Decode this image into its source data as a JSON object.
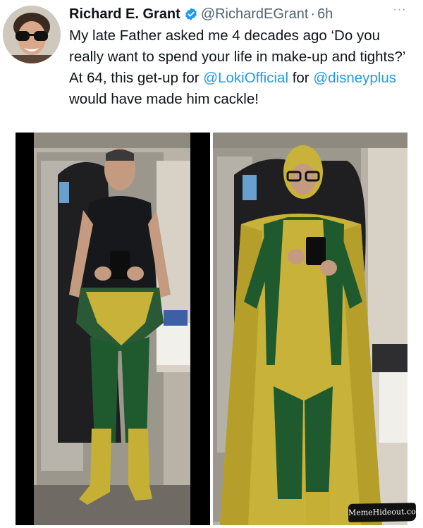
{
  "tweet": {
    "author": {
      "display_name": "Richard E. Grant",
      "handle": "@RichardEGrant",
      "separator": "·",
      "time": "6h",
      "verified_icon": "verified-badge-icon",
      "avatar": "profile-avatar"
    },
    "more_label": "···",
    "text": {
      "line_1": "My late Father asked me 4 decades ago ‘Do you really want to spend your life in make-up and tights?’  At 64, this get-up for ",
      "mention_1": "@LokiOfficial",
      "middle": " for ",
      "mention_2": "@disneyplus",
      "end": " would have made him cackle!"
    },
    "media": {
      "photos": [
        {
          "name": "mirror-selfie-costume-top-off"
        },
        {
          "name": "mirror-selfie-full-costume"
        }
      ]
    }
  },
  "watermark": {
    "text": "MemeHideout.com"
  },
  "colors": {
    "link": "#1d9bf0",
    "verified": "#1d9bf0",
    "secondary_text": "#536471",
    "costume_yellow": "#c9b23a",
    "costume_green": "#1f5a2f"
  }
}
